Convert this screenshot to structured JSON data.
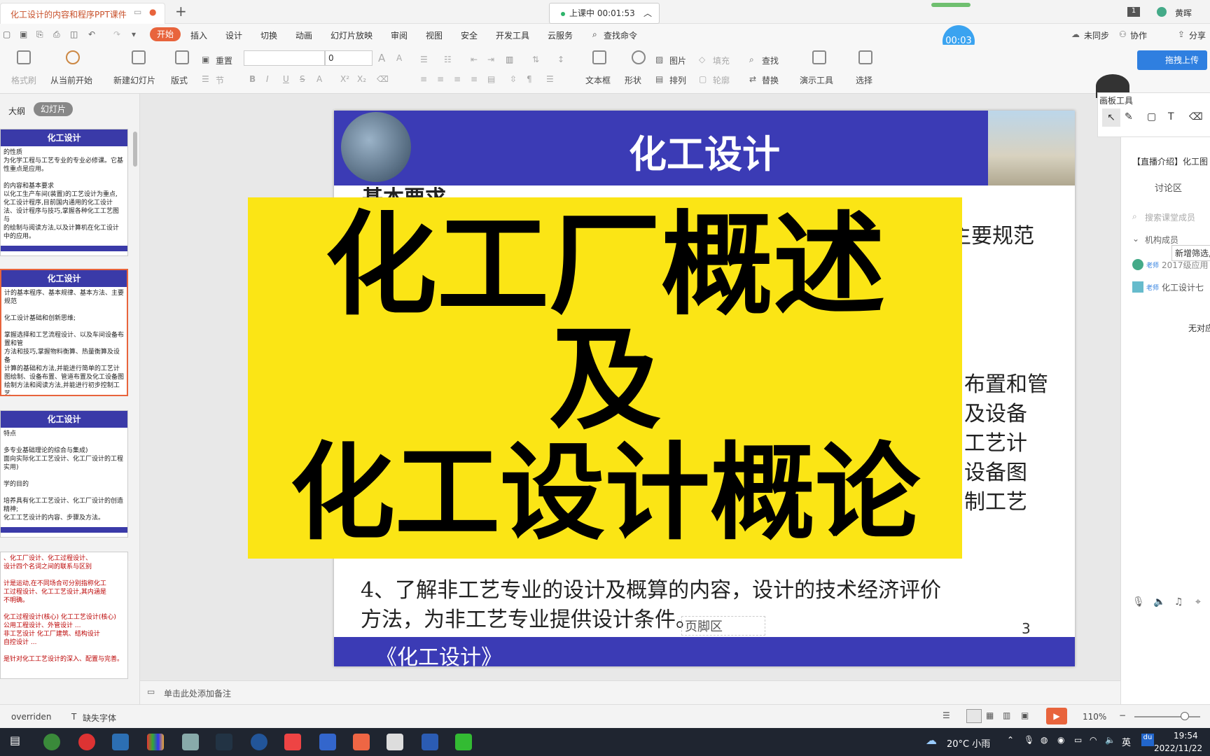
{
  "window": {
    "tab_title": "化工设计的内容和程序PPT课件",
    "live_status": "上课中 00:01:53",
    "user_name": "黄晖",
    "timer": "00:03",
    "not_synced": "未同步",
    "collab": "协作",
    "share": "分享"
  },
  "ribbon_tabs": [
    "开始",
    "插入",
    "设计",
    "切换",
    "动画",
    "幻灯片放映",
    "审阅",
    "视图",
    "安全",
    "开发工具",
    "云服务"
  ],
  "search_cmd": "查找命令",
  "toolbar": {
    "format_brush": "格式刷",
    "from_current": "从当前开始",
    "new_slide": "新建幻灯片",
    "layout": "版式",
    "reset": "重置",
    "section": "节",
    "font_size": "0",
    "textbox": "文本框",
    "shape": "形状",
    "picture": "图片",
    "arrange": "排列",
    "fill": "填充",
    "outline": "轮廓",
    "find": "查找",
    "replace": "替换",
    "present_tools": "演示工具",
    "select": "选择",
    "upload": "拖拽上传"
  },
  "left_panel": {
    "tab_outline": "大纲",
    "tab_slides": "幻灯片",
    "thumbs": [
      {
        "title": "化工设计",
        "text": "的性质\n为化学工程与工艺专业的专业必修课。它基\n性重点是应用。\n\n的内容和基本要求\n以化工生产车间(装置)的工艺设计为重点,\n化工设计程序,目前国内通用的化工设计\n法、设计程序与技巧,掌握各种化工工艺图与\n的绘制与阅读方法,以及计算机在化工设计\n中的应用。"
      },
      {
        "title": "化工设计",
        "text": "计的基本程序、基本规律、基本方法、主要规范\n\n化工设计基础和创新思维;\n\n掌握选择和工艺流程设计、以及车间设备布置和管\n方法和技巧,掌握物料衡算、热量衡算及设备\n计算的基础和方法,并能进行简单的工艺计\n图绘制、设备布置、管道布置及化工设备图\n绘制方法和阅读方法,并能进行初步控制工艺\n工设备图绘制\n\n专业的设计及概算的内容,设计的技术经济评价\n艺专业提供设计条件。"
      },
      {
        "title": "化工设计",
        "text": "特点\n\n多专业基础理论的综合与集成)\n面向实际化工工艺设计、化工厂设计的工程实用)\n\n学的目的\n\n培养具有化工工艺设计、化工厂设计的创造精神;\n化工工艺设计的内容、步骤及方法。"
      },
      {
        "title": "",
        "text": "、化工厂设计、化工过程设计、\n设计四个名词之间的联系与区别\n\n计是运动,在不同场合可分别指称化工\n工过程设计、化工工艺设计,其内涵是\n不明确。\n\n化工过程设计(核心)  化工工艺设计(核心)\n公用工程设计、外管设计 ...\n非工艺设计  化工厂建筑、结构设计\n自控设计 ...\n\n是针对化工工艺设计的深入、配置与完善。"
      }
    ]
  },
  "slide": {
    "title": "化工设计",
    "partial_heading": "基本要求",
    "partial_right_1": "主要规范",
    "partial_right_lines": [
      "布置和管",
      "及设备",
      "工艺计",
      "设备图",
      "制工艺"
    ],
    "item4_line1": "4、了解非工艺专业的设计及概算的内容，设计的技术经济评价",
    "item4_line2": "方法，为非工艺专业提供设计条件。",
    "footer_placeholder": "页脚区",
    "page_number": "3",
    "footer_title": "《化工设计》"
  },
  "overlay": {
    "line1": "化工厂概述",
    "line2": "及",
    "line3": "化工设计概论"
  },
  "right_panel": {
    "board_tools": "画板工具",
    "live_intro": "【直播介绍】化工图",
    "discussion": "讨论区",
    "search_placeholder": "搜索课堂成员",
    "org": "机构成员",
    "new_filter": "新增筛选,",
    "member1": "2017级应用",
    "member2": "化工设计七",
    "teacher_tag": "老师",
    "no_reply": "无对应"
  },
  "notes": {
    "placeholder": "单击此处添加备注"
  },
  "status": {
    "overridden": "overriden",
    "missing_font": "缺失字体",
    "zoom": "110%"
  },
  "taskbar": {
    "weather": "20°C 小雨",
    "ime": "英",
    "time": "19:54",
    "date": "2022/11/22"
  }
}
